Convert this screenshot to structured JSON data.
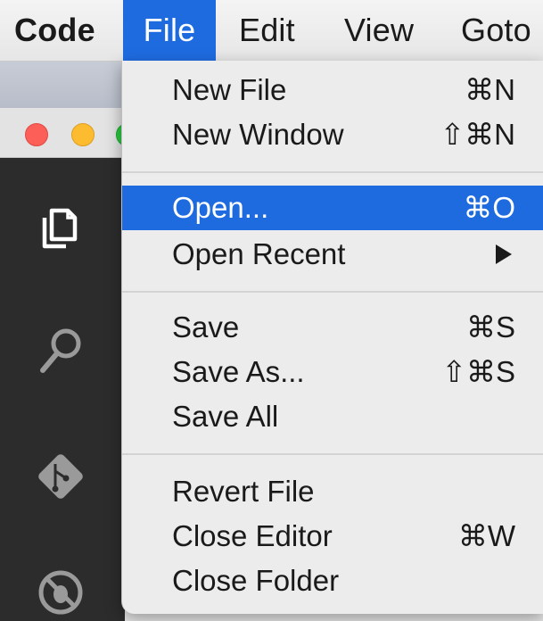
{
  "menubar": {
    "app": "Code",
    "items": [
      "File",
      "Edit",
      "View",
      "Goto"
    ]
  },
  "file_menu": {
    "new_file": {
      "label": "New File",
      "shortcut": "⌘N"
    },
    "new_window": {
      "label": "New Window",
      "shortcut": "⇧⌘N"
    },
    "open": {
      "label": "Open...",
      "shortcut": "⌘O"
    },
    "open_recent": {
      "label": "Open Recent"
    },
    "save": {
      "label": "Save",
      "shortcut": "⌘S"
    },
    "save_as": {
      "label": "Save As...",
      "shortcut": "⇧⌘S"
    },
    "save_all": {
      "label": "Save All"
    },
    "revert_file": {
      "label": "Revert File"
    },
    "close_editor": {
      "label": "Close Editor",
      "shortcut": "⌘W"
    },
    "close_folder": {
      "label": "Close Folder"
    }
  },
  "activity_bar": {
    "icons": [
      "explorer-icon",
      "search-icon",
      "git-icon",
      "debug-icon"
    ]
  },
  "colors": {
    "highlight": "#1e6be0",
    "activity_bar": "#2c2c2c",
    "menu_bg": "#ececec"
  }
}
